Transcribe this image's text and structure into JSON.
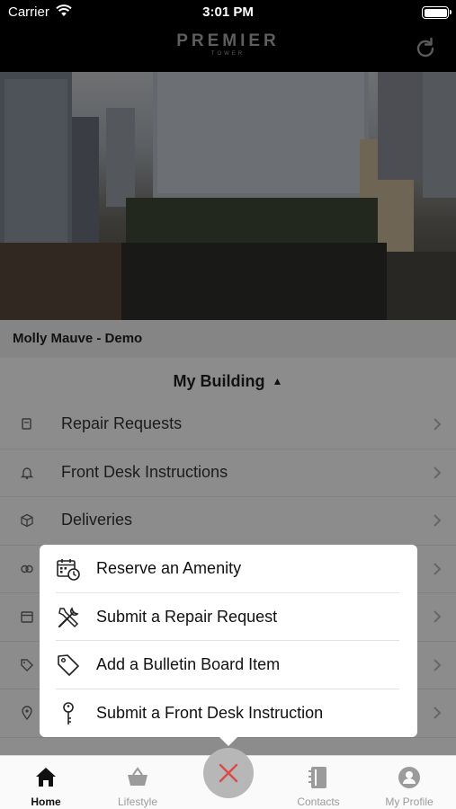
{
  "status": {
    "carrier": "Carrier",
    "time": "3:01 PM"
  },
  "nav": {
    "logo_main": "PREMIER",
    "logo_sub": "TOWER",
    "refresh_icon": "refresh-icon"
  },
  "user": {
    "name": "Molly Mauve - Demo"
  },
  "section": {
    "title": "My Building"
  },
  "list_items": [
    {
      "label": "Repair Requests",
      "icon": "tools-icon"
    },
    {
      "label": "Front Desk Instructions",
      "icon": "bell-icon"
    },
    {
      "label": "Deliveries",
      "icon": "box-icon"
    },
    {
      "label": "",
      "icon": "links-icon"
    },
    {
      "label": "",
      "icon": "calendar-icon"
    },
    {
      "label": "",
      "icon": "tag-icon"
    },
    {
      "label": "",
      "icon": "location-icon"
    }
  ],
  "popup": {
    "items": [
      {
        "label": "Reserve an Amenity",
        "icon": "calendar-clock-icon"
      },
      {
        "label": "Submit a Repair Request",
        "icon": "tools-icon"
      },
      {
        "label": "Add a Bulletin Board Item",
        "icon": "tag-icon"
      },
      {
        "label": "Submit a Front Desk Instruction",
        "icon": "key-icon"
      }
    ]
  },
  "tabs": [
    {
      "label": "Home",
      "icon": "home-icon",
      "active": true
    },
    {
      "label": "Lifestyle",
      "icon": "basket-icon",
      "active": false
    },
    {
      "label": "Contacts",
      "icon": "address-book-icon",
      "active": false
    },
    {
      "label": "My Profile",
      "icon": "person-icon",
      "active": false
    }
  ],
  "colors": {
    "fab": "#b7b7b7",
    "overlay": "rgba(0,0,0,0.45)",
    "tab_active": "#111111",
    "tab_inactive": "#9b9b9b"
  }
}
